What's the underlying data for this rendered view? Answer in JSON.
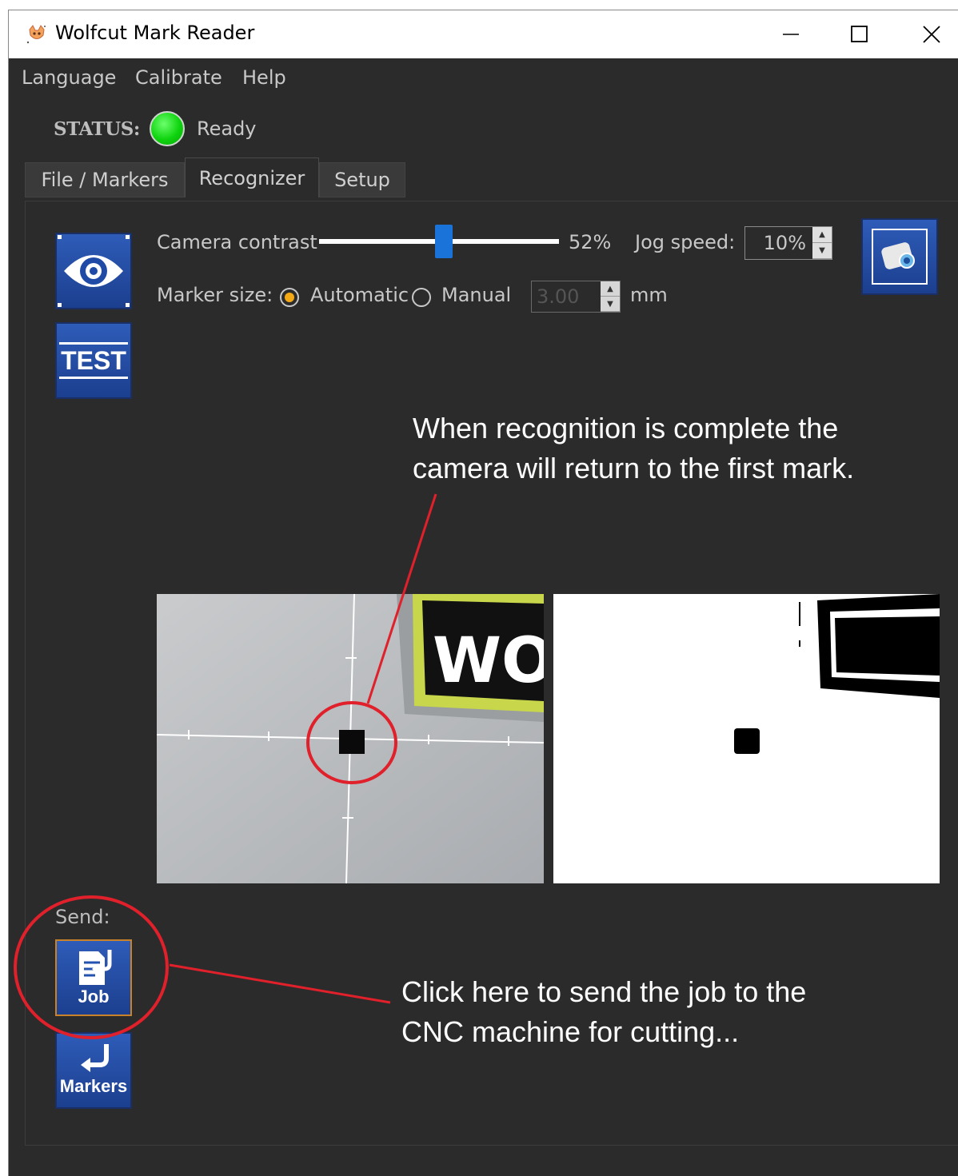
{
  "window": {
    "title": "Wolfcut Mark Reader"
  },
  "menu": {
    "items": [
      "Language",
      "Calibrate",
      "Help"
    ]
  },
  "status": {
    "label": "STATUS:",
    "text": "Ready",
    "color": "#16d016"
  },
  "tabs": [
    {
      "label": "File / Markers",
      "active": false
    },
    {
      "label": "Recognizer",
      "active": true
    },
    {
      "label": "Setup",
      "active": false
    }
  ],
  "controls": {
    "camera_contrast_label": "Camera contrast",
    "camera_contrast_value_text": "52%",
    "camera_contrast_level": 0.52,
    "jog_speed_label": "Jog speed:",
    "jog_speed_value": "10%",
    "marker_size_label": "Marker size:",
    "automatic_label": "Automatic",
    "manual_label": "Manual",
    "marker_size_selected": "Automatic",
    "manual_size_value": "3.00",
    "unit": "mm"
  },
  "buttons": {
    "test_label": "TEST",
    "job_label": "Job",
    "markers_label": "Markers"
  },
  "send": {
    "label": "Send:"
  },
  "camera_preview": {
    "logo_text": "WO"
  },
  "annotations": {
    "top_line1": "When recognition is complete the",
    "top_line2": "camera will return to the first mark.",
    "bottom_line1": "Click here to send the job to the",
    "bottom_line2": "CNC machine for cutting..."
  },
  "colors": {
    "annotation_red": "#e0202a",
    "button_blue": "#2452b0",
    "slider_blue": "#1a73d9",
    "radio_selected": "#f3a815"
  }
}
